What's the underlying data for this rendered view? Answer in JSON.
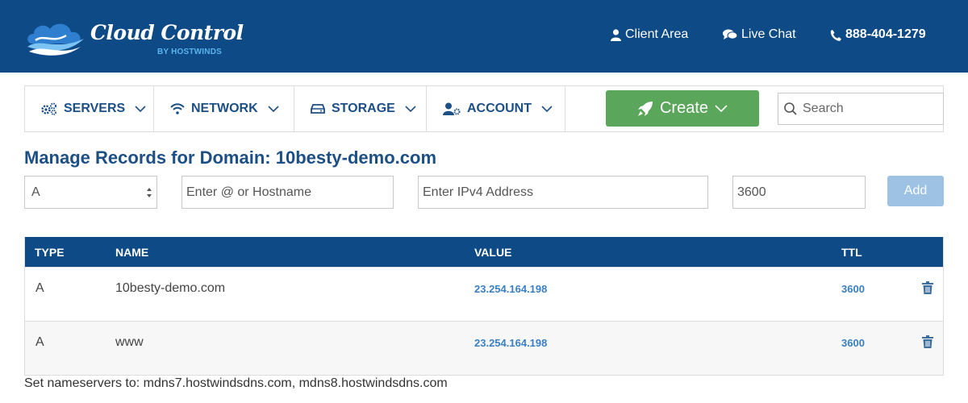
{
  "brand": {
    "name": "Cloud Control",
    "byline": "BY HOSTWINDS"
  },
  "header_links": {
    "client_area": "Client Area",
    "live_chat": "Live Chat",
    "phone": "888-404-1279"
  },
  "nav": {
    "items": [
      {
        "label": "SERVERS",
        "icon": "gears-icon"
      },
      {
        "label": "NETWORK",
        "icon": "wifi-icon"
      },
      {
        "label": "STORAGE",
        "icon": "hard-drive-icon"
      },
      {
        "label": "ACCOUNT",
        "icon": "user-gear-icon"
      }
    ],
    "create_label": "Create",
    "search_placeholder": "Search"
  },
  "page": {
    "title": "Manage Records for Domain: 10besty-demo.com"
  },
  "form": {
    "type_selected": "A",
    "hostname_placeholder": "Enter @ or Hostname",
    "ipv4_placeholder": "Enter IPv4 Address",
    "ttl_value": "3600",
    "add_label": "Add"
  },
  "table": {
    "headers": {
      "type": "TYPE",
      "name": "NAME",
      "value": "VALUE",
      "ttl": "TTL"
    },
    "rows": [
      {
        "type": "A",
        "name": "10besty-demo.com",
        "value": "23.254.164.198",
        "ttl": "3600"
      },
      {
        "type": "A",
        "name": "www",
        "value": "23.254.164.198",
        "ttl": "3600"
      }
    ]
  },
  "footer": {
    "nameservers_note": "Set nameservers to: mdns7.hostwindsdns.com, mdns8.hostwindsdns.com"
  },
  "colors": {
    "header_bg": "#0d4a86",
    "accent_text": "#1c4f86",
    "create_green": "#5aa65a",
    "add_disabled": "#9dc2e4",
    "value_link": "#3a7fc2"
  }
}
